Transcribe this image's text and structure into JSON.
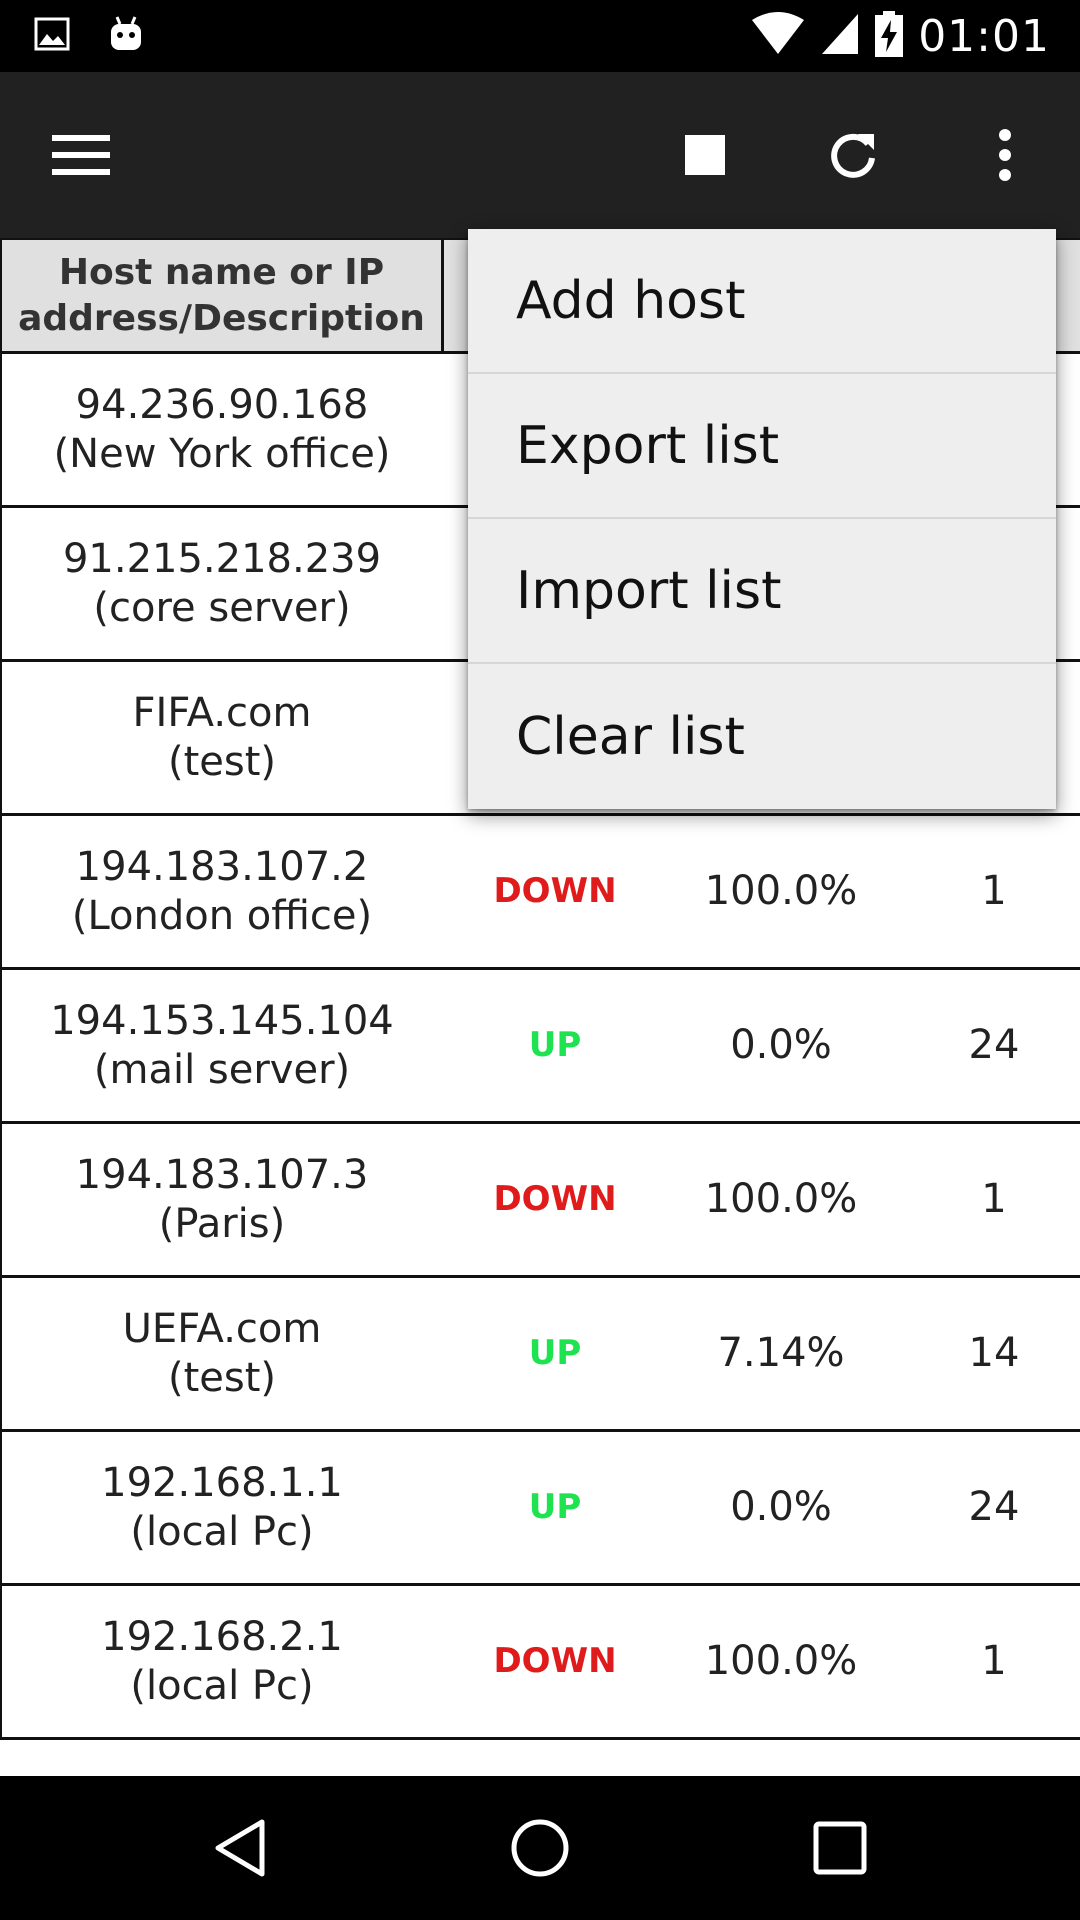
{
  "status_bar": {
    "time": "01:01",
    "icons": [
      "image-icon",
      "android-icon",
      "wifi-icon",
      "signal-icon",
      "battery-charging-icon"
    ]
  },
  "toolbar": {
    "menu_icon": "hamburger-menu-icon",
    "stop_icon": "stop-icon",
    "refresh_icon": "refresh-icon",
    "more_icon": "more-vert-icon"
  },
  "table": {
    "headers": {
      "host_line1": "Host name or IP",
      "host_line2": "address/Description"
    },
    "rows": [
      {
        "host": "94.236.90.168",
        "desc": "(New York office)",
        "status": "",
        "loss": "",
        "count": ""
      },
      {
        "host": "91.215.218.239",
        "desc": "(core server)",
        "status": "",
        "loss": "",
        "count": ""
      },
      {
        "host": "FIFA.com",
        "desc": "(test)",
        "status": "",
        "loss": "",
        "count": ""
      },
      {
        "host": "194.183.107.2",
        "desc": "(London office)",
        "status": "DOWN",
        "loss": "100.0%",
        "count": "1"
      },
      {
        "host": "194.153.145.104",
        "desc": "(mail server)",
        "status": "UP",
        "loss": "0.0%",
        "count": "24"
      },
      {
        "host": "194.183.107.3",
        "desc": "(Paris)",
        "status": "DOWN",
        "loss": "100.0%",
        "count": "1"
      },
      {
        "host": "UEFA.com",
        "desc": "(test)",
        "status": "UP",
        "loss": "7.14%",
        "count": "14"
      },
      {
        "host": "192.168.1.1",
        "desc": "(local Pc)",
        "status": "UP",
        "loss": "0.0%",
        "count": "24"
      },
      {
        "host": "192.168.2.1",
        "desc": "(local Pc)",
        "status": "DOWN",
        "loss": "100.0%",
        "count": "1"
      }
    ]
  },
  "popup_menu": {
    "items": [
      "Add host",
      "Export list",
      "Import list",
      "Clear list"
    ]
  },
  "colors": {
    "up": "#1ee24f",
    "down": "#e01b1b",
    "toolbar": "#212121",
    "header_bg": "#e0e0e0"
  },
  "nav_bar": {
    "back_icon": "back-icon",
    "home_icon": "home-icon",
    "recents_icon": "recents-icon"
  }
}
